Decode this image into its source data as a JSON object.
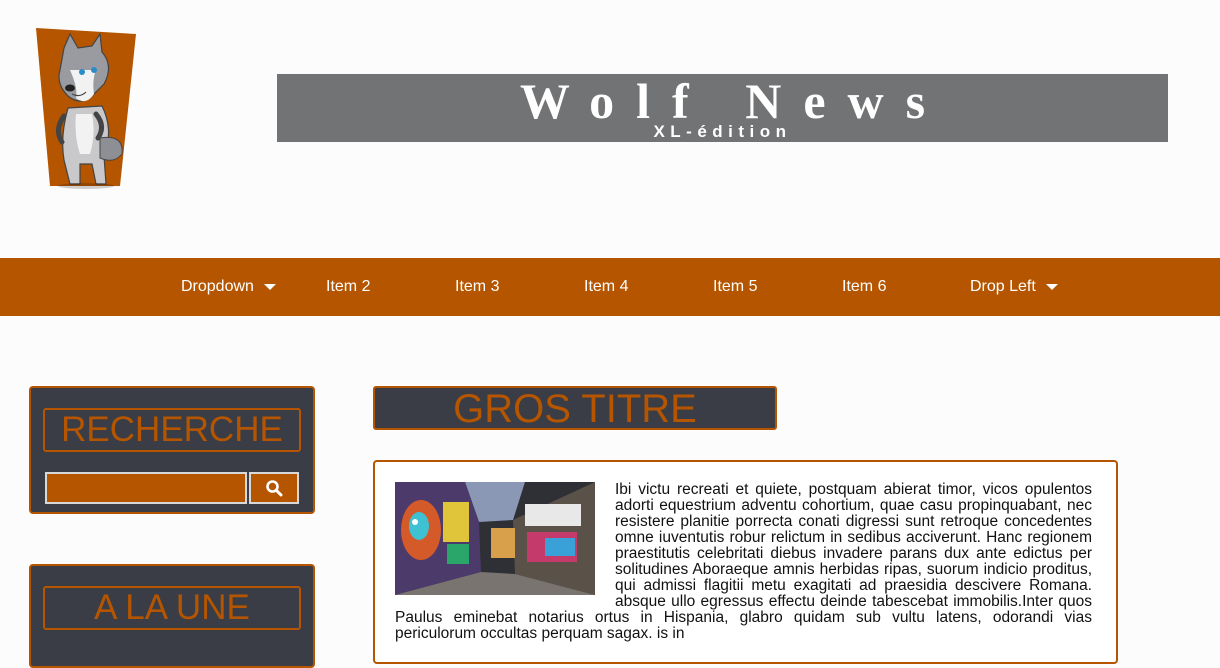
{
  "header": {
    "title": "Wolf News",
    "subtitle": "XL-édition",
    "logo_icon": "wolf-mascot-icon"
  },
  "nav": {
    "items": [
      {
        "label": "Dropdown",
        "has_caret": true
      },
      {
        "label": "Item 2",
        "has_caret": false
      },
      {
        "label": "Item 3",
        "has_caret": false
      },
      {
        "label": "Item 4",
        "has_caret": false
      },
      {
        "label": "Item 5",
        "has_caret": false
      },
      {
        "label": "Item 6",
        "has_caret": false
      },
      {
        "label": "Drop Left",
        "has_caret": true
      }
    ]
  },
  "sidebar": {
    "search": {
      "title": "RECHERCHE",
      "input_value": "",
      "placeholder": "",
      "button_icon": "search-icon"
    },
    "featured": {
      "title": "A LA UNE"
    }
  },
  "main": {
    "headline": "GROS TITRE",
    "article": {
      "image_alt": "graffiti-alley-photo",
      "text": "Ibi victu recreati et quiete, postquam abierat timor, vicos opulentos adorti equestrium adventu cohortium, quae casu propinquabant, nec resistere planitie porrecta conati digressi sunt retroque concedentes omne iuventutis robur relictum in sedibus acciverunt. Hanc regionem praestitutis celebritati diebus invadere parans dux ante edictus per solitudines Aboraeque amnis herbidas ripas, suorum indicio proditus, qui admissi flagitii metu exagitati ad praesidia descivere Romana. absque ullo egressus effectu deinde tabescebat immobilis.Inter quos Paulus eminebat notarius ortus in Hispania, glabro quidam sub vultu latens, odorandi vias periculorum occultas perquam sagax. is in"
    }
  },
  "colors": {
    "accent": "#b55500",
    "dark_panel": "#3a3d45",
    "banner_gray": "#727374",
    "background": "#fcfcfc"
  }
}
